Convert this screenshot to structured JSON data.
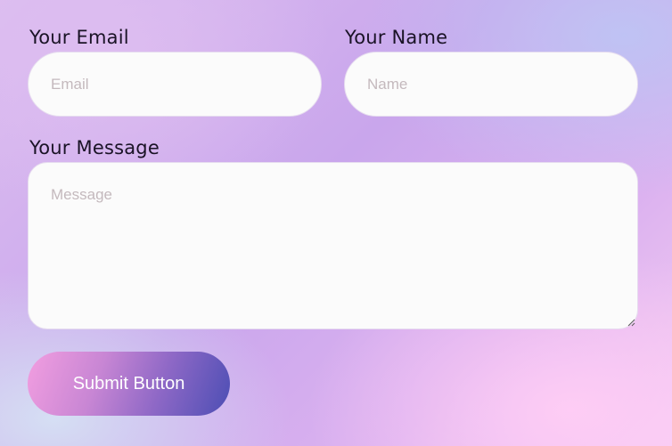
{
  "form": {
    "email": {
      "label": "Your Email",
      "placeholder": "Email",
      "value": ""
    },
    "name": {
      "label": "Your Name",
      "placeholder": "Name",
      "value": ""
    },
    "message": {
      "label": "Your Message",
      "placeholder": "Message",
      "value": ""
    },
    "submit_label": "Submit Button"
  },
  "colors": {
    "field_background": "#fbfbfb",
    "label_text": "#1a1326",
    "placeholder_text": "#c4b9bd",
    "button_gradient_start": "#f29ee0",
    "button_gradient_end": "#4c4eb4",
    "button_text": "#ffffff"
  },
  "icons": {
    "textarea_resize": "resize-handle-icon"
  }
}
